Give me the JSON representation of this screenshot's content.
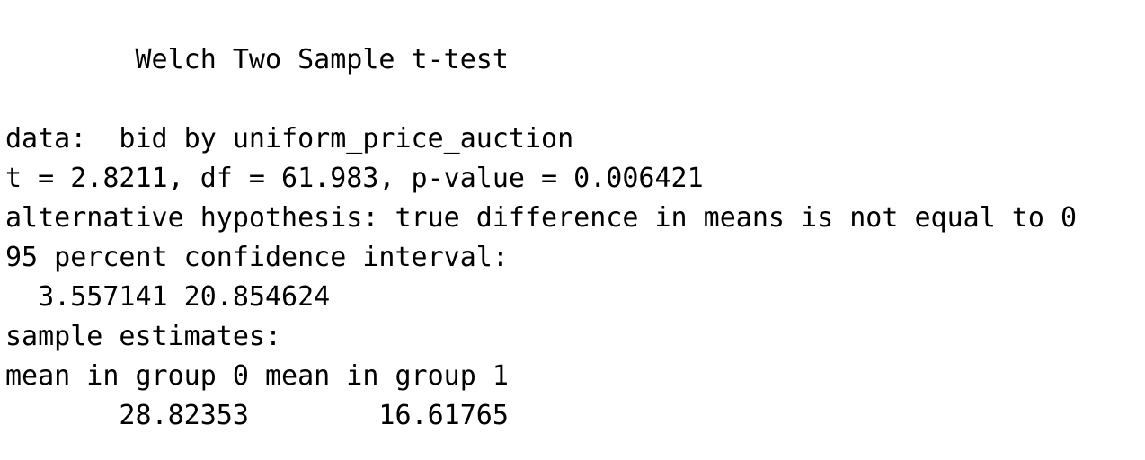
{
  "output": {
    "title": "        Welch Two Sample t-test",
    "data_line": "data:  bid by uniform_price_auction",
    "stats_line": "t = 2.8211, df = 61.983, p-value = 0.006421",
    "alternative_line": "alternative hypothesis: true difference in means is not equal to 0",
    "ci_header": "95 percent confidence interval:",
    "ci_values": "  3.557141 20.854624",
    "estimates_header": "sample estimates:",
    "estimates_labels": "mean in group 0 mean in group 1",
    "estimates_values": "       28.82353        16.61765"
  }
}
